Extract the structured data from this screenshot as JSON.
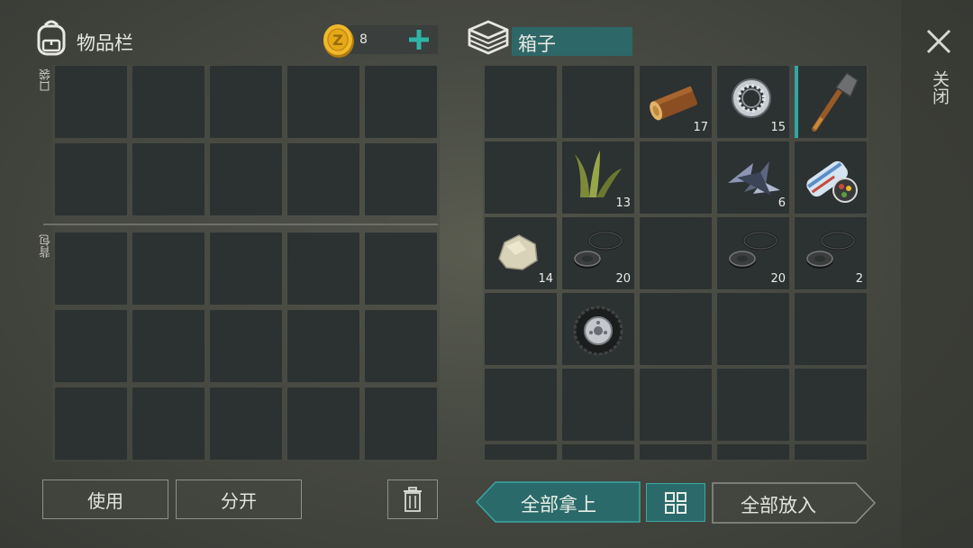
{
  "inventory": {
    "title": "物品栏",
    "pocket_label": "口袋",
    "backpack_label": "背包",
    "coins": "8"
  },
  "container": {
    "title": "箱子",
    "items": [
      {
        "name": "log",
        "qty": "17"
      },
      {
        "name": "bearing",
        "qty": "15"
      },
      {
        "name": "shovel",
        "qty": ""
      },
      {
        "name": "plant-fiber",
        "qty": "13"
      },
      {
        "name": "metal-scrap",
        "qty": "6"
      },
      {
        "name": "blueprint",
        "qty": ""
      },
      {
        "name": "stone",
        "qty": "14"
      },
      {
        "name": "rubber-parts",
        "qty": "20"
      },
      {
        "name": "rubber-parts",
        "qty": "20"
      },
      {
        "name": "rubber-parts",
        "qty": "2"
      },
      {
        "name": "wheel",
        "qty": ""
      }
    ]
  },
  "buttons": {
    "use": "使用",
    "split": "分开",
    "take_all": "全部拿上",
    "put_all": "全部放入"
  },
  "close_label": "关闭",
  "colors": {
    "accent": "#2b6a6a",
    "accent_border": "#3aa8a4",
    "plus": "#2fb4a8"
  }
}
